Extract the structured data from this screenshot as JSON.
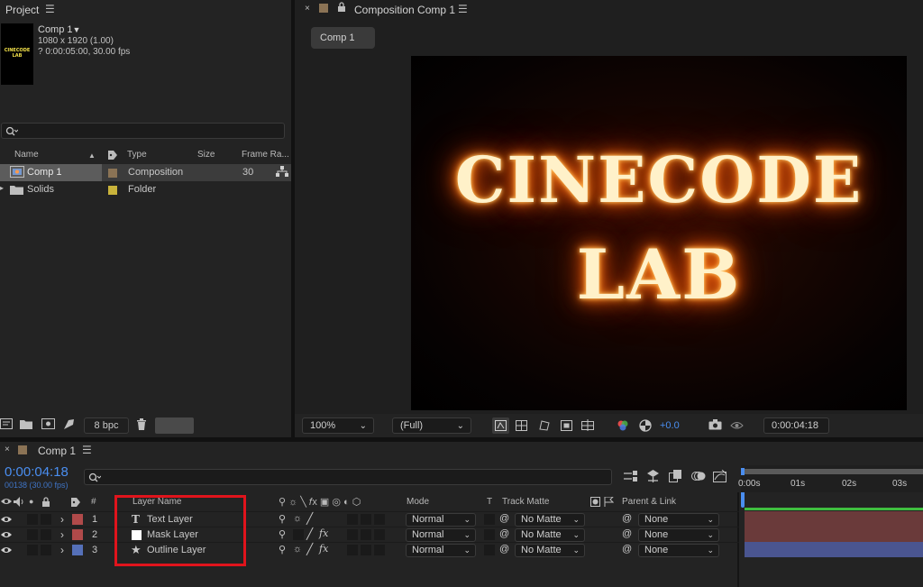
{
  "project": {
    "title": "Project",
    "comp_name": "Comp 1",
    "comp_dims": "1080 x 1920 (1.00)",
    "comp_duration": "? 0:00:05:00, 30.00 fps",
    "thumb_line1": "CINECODE",
    "thumb_line2": "LAB",
    "columns": [
      "Name",
      "Type",
      "Size",
      "Frame Ra..."
    ],
    "items": [
      {
        "name": "Comp 1",
        "type": "Composition",
        "frame_rate": "30",
        "color": "#8b7355"
      },
      {
        "name": "Solids",
        "type": "Folder",
        "frame_rate": "",
        "color": "#c9b33b"
      }
    ],
    "bpc": "8 bpc"
  },
  "viewer": {
    "tab_title": "Composition Comp 1",
    "comp_tab": "Comp 1",
    "canvas_line1": "CINECODE",
    "canvas_line2": "LAB",
    "zoom": "100%",
    "resolution": "(Full)",
    "exposure": "+0.0",
    "timecode": "0:00:04:18"
  },
  "timeline": {
    "tab_title": "Comp 1",
    "timecode": "0:00:04:18",
    "frame_info": "00138 (30.00 fps)",
    "columns": {
      "number": "#",
      "layer_name": "Layer Name",
      "mode": "Mode",
      "t": "T",
      "track_matte": "Track Matte",
      "parent": "Parent & Link"
    },
    "layers": [
      {
        "num": "1",
        "name": "Text Layer",
        "icon": "T",
        "mode": "Normal",
        "matte": "No Matte",
        "parent": "None",
        "label_color": "#b04a4a",
        "track_color": "#6a3a3a"
      },
      {
        "num": "2",
        "name": "Mask Layer",
        "icon": "solid",
        "mode": "Normal",
        "matte": "No Matte",
        "parent": "None",
        "label_color": "#b04a4a",
        "track_color": "#6a3a3a"
      },
      {
        "num": "3",
        "name": "Outline Layer",
        "icon": "star",
        "mode": "Normal",
        "matte": "No Matte",
        "parent": "None",
        "label_color": "#5570b8",
        "track_color": "#4a5590"
      }
    ],
    "ruler_ticks": [
      "0:00s",
      "01s",
      "02s",
      "03s"
    ]
  }
}
